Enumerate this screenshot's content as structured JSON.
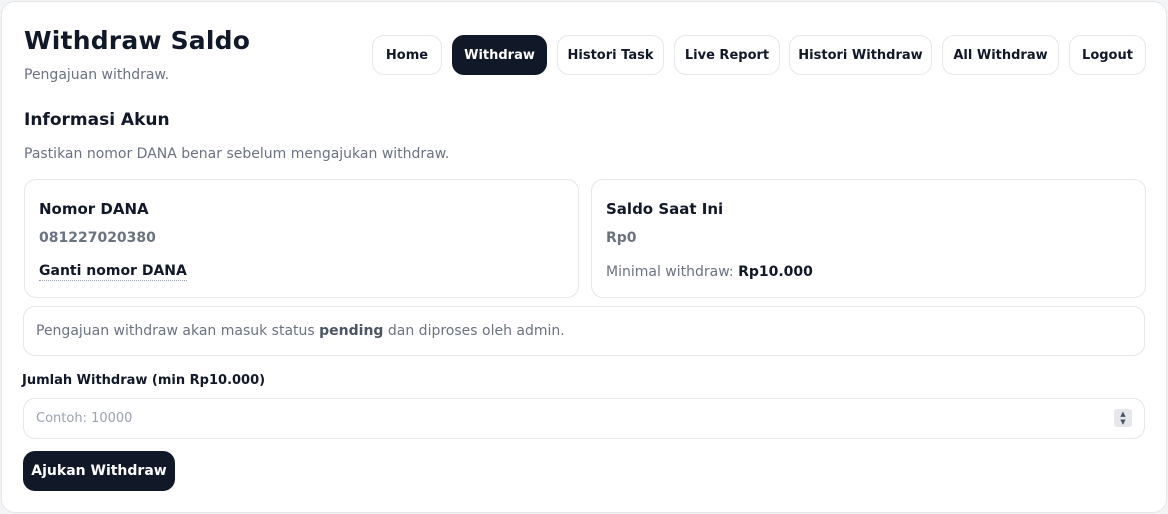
{
  "header": {
    "title": "Withdraw Saldo",
    "subtitle": "Pengajuan withdraw."
  },
  "nav": {
    "items": [
      {
        "label": "Home",
        "active": false
      },
      {
        "label": "Withdraw",
        "active": true
      },
      {
        "label": "Histori Task",
        "active": false
      },
      {
        "label": "Live Report",
        "active": false
      },
      {
        "label": "Histori Withdraw",
        "active": false
      },
      {
        "label": "All Withdraw",
        "active": false
      },
      {
        "label": "Logout",
        "active": false
      }
    ]
  },
  "account": {
    "title": "Informasi Akun",
    "description": "Pastikan nomor DANA benar sebelum mengajukan withdraw.",
    "dana": {
      "label": "Nomor DANA",
      "value": "081227020380",
      "change_label": "Ganti nomor DANA"
    },
    "balance": {
      "label": "Saldo Saat Ini",
      "value": "Rp0",
      "min_label": "Minimal withdraw:",
      "min_value": "Rp10.000"
    }
  },
  "notice": {
    "prefix": "Pengajuan withdraw akan masuk status",
    "status": "pending",
    "suffix": "dan diproses oleh admin."
  },
  "form": {
    "amount_label": "Jumlah Withdraw (min Rp10.000)",
    "amount_placeholder": "Contoh: 10000",
    "amount_value": "",
    "submit_label": "Ajukan Withdraw"
  },
  "colors": {
    "primary": "#111827",
    "muted": "#6b7280",
    "border": "#e5e7eb"
  },
  "icons": {
    "spinner": "number-stepper-icon"
  }
}
